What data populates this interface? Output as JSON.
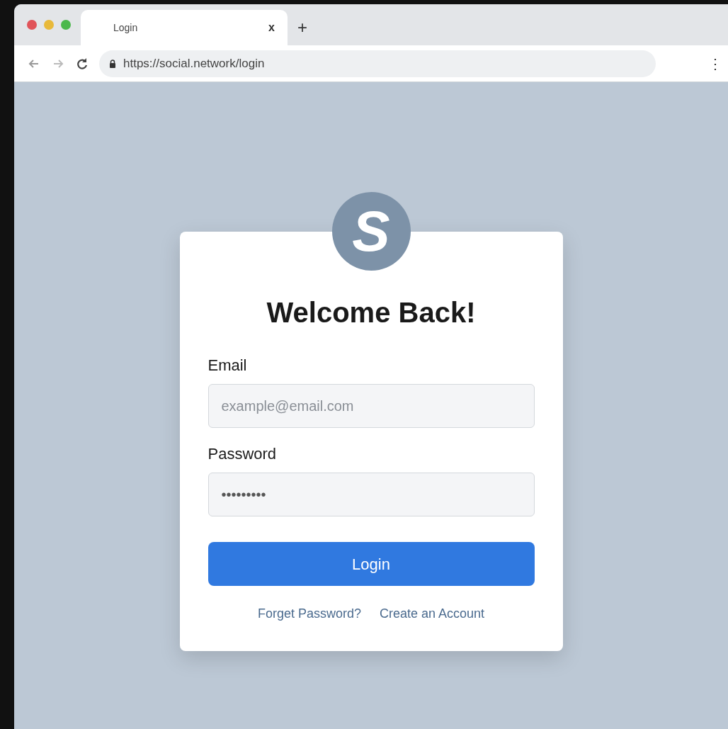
{
  "browser": {
    "tab": {
      "title": "Login",
      "close": "x",
      "selected": true
    },
    "new_tab": "+",
    "address": "https://social.network/login",
    "menu": "⋮"
  },
  "logo": {
    "letter": "S"
  },
  "form": {
    "title": "Welcome Back!",
    "fields": [
      {
        "label": "Email",
        "placeholder": "example@email.com"
      },
      {
        "label": "Password",
        "value": "•••••••••"
      }
    ],
    "button": "Login",
    "links": [
      "Forget Password?",
      "Create an Account"
    ]
  }
}
